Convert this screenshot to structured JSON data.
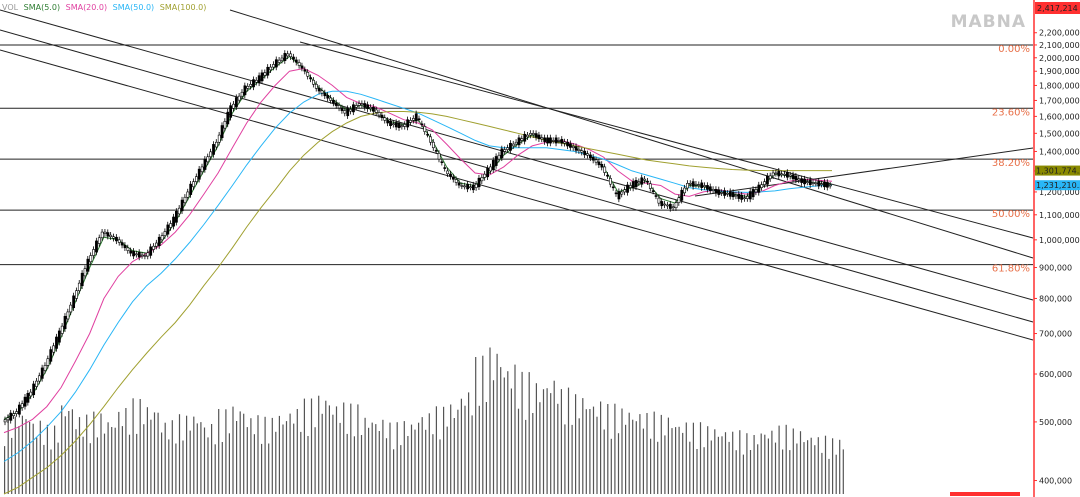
{
  "watermark": "MABNA",
  "legend": [
    {
      "label": "VOL",
      "color": "#999999"
    },
    {
      "label": "SMA(5.0)",
      "color": "#2e7d32"
    },
    {
      "label": "SMA(20.0)",
      "color": "#e040a0"
    },
    {
      "label": "SMA(50.0)",
      "color": "#29b6f6"
    },
    {
      "label": "SMA(100.0)",
      "color": "#a0a030"
    }
  ],
  "chart_data": {
    "type": "candlestick",
    "scale": "log",
    "ylim": [
      380000,
      2417214
    ],
    "y_ticks": [
      2200000,
      2100000,
      2000000,
      1900000,
      1800000,
      1700000,
      1600000,
      1500000,
      1400000,
      1300000,
      1200000,
      1100000,
      1000000,
      900000,
      800000,
      700000,
      600000,
      500000,
      400000
    ],
    "y_tick_labels": [
      "2,200,000",
      "2,100,000",
      "2,000,000",
      "1,900,000",
      "1,800,000",
      "1,700,000",
      "1,600,000",
      "1,500,000",
      "1,400,000",
      "1,300,000",
      "1,200,000",
      "1,100,000",
      "1,000,000",
      "900,000",
      "800,000",
      "700,000",
      "600,000",
      "500,000",
      "400,000"
    ],
    "top_value_label": "2,417,214",
    "price_tags": [
      {
        "text": "1,301,774.2",
        "color": "#8a8a00"
      },
      {
        "text": "1,231,210.5",
        "color": "#29b6f6"
      }
    ],
    "close_path": [
      500000,
      520000,
      560000,
      620000,
      700000,
      800000,
      920000,
      1030000,
      1000000,
      950000,
      940000,
      1000000,
      1080000,
      1200000,
      1320000,
      1450000,
      1650000,
      1780000,
      1850000,
      1950000,
      2030000,
      1920000,
      1780000,
      1700000,
      1620000,
      1680000,
      1640000,
      1560000,
      1540000,
      1600000,
      1450000,
      1300000,
      1230000,
      1220000,
      1300000,
      1400000,
      1450000,
      1500000,
      1460000,
      1460000,
      1420000,
      1380000,
      1320000,
      1180000,
      1230000,
      1260000,
      1150000,
      1130000,
      1240000,
      1230000,
      1200000,
      1190000,
      1170000,
      1220000,
      1290000,
      1280000,
      1250000,
      1240000,
      1230000
    ],
    "sma_lines": {
      "sma5": [
        505000,
        520000,
        555000,
        610000,
        690000,
        790000,
        900000,
        1010000,
        1000000,
        960000,
        950000,
        990000,
        1070000,
        1180000,
        1300000,
        1430000,
        1620000,
        1760000,
        1840000,
        1930000,
        2010000,
        1920000,
        1790000,
        1710000,
        1640000,
        1670000,
        1630000,
        1570000,
        1550000,
        1580000,
        1460000,
        1320000,
        1240000,
        1230000,
        1290000,
        1380000,
        1440000,
        1490000,
        1460000,
        1450000,
        1420000,
        1380000,
        1320000,
        1200000,
        1220000,
        1250000,
        1170000,
        1150000,
        1230000,
        1225000,
        1200000,
        1190000,
        1180000,
        1220000,
        1285000,
        1275000,
        1250000,
        1240000,
        1232000
      ],
      "sma20": [
        480000,
        490000,
        505000,
        530000,
        570000,
        630000,
        700000,
        800000,
        870000,
        920000,
        950000,
        980000,
        1030000,
        1100000,
        1190000,
        1290000,
        1420000,
        1560000,
        1690000,
        1800000,
        1900000,
        1920000,
        1870000,
        1800000,
        1720000,
        1680000,
        1660000,
        1620000,
        1580000,
        1560000,
        1520000,
        1440000,
        1360000,
        1290000,
        1280000,
        1320000,
        1380000,
        1430000,
        1450000,
        1460000,
        1440000,
        1410000,
        1370000,
        1300000,
        1250000,
        1240000,
        1230000,
        1190000,
        1180000,
        1200000,
        1210000,
        1200000,
        1190000,
        1200000,
        1230000,
        1250000,
        1260000,
        1255000,
        1250000
      ],
      "sma50": [
        430000,
        445000,
        465000,
        490000,
        520000,
        560000,
        610000,
        670000,
        730000,
        790000,
        840000,
        880000,
        930000,
        990000,
        1060000,
        1140000,
        1230000,
        1330000,
        1430000,
        1530000,
        1620000,
        1690000,
        1740000,
        1760000,
        1760000,
        1740000,
        1710000,
        1680000,
        1650000,
        1620000,
        1580000,
        1540000,
        1500000,
        1460000,
        1430000,
        1420000,
        1420000,
        1420000,
        1420000,
        1410000,
        1400000,
        1380000,
        1360000,
        1330000,
        1300000,
        1280000,
        1260000,
        1240000,
        1220000,
        1210000,
        1205000,
        1200000,
        1198000,
        1200000,
        1205000,
        1215000,
        1222000,
        1228000,
        1231210
      ],
      "sma100": [
        380000,
        390000,
        405000,
        420000,
        440000,
        465000,
        495000,
        530000,
        570000,
        610000,
        650000,
        690000,
        730000,
        780000,
        840000,
        900000,
        970000,
        1050000,
        1130000,
        1210000,
        1300000,
        1380000,
        1450000,
        1510000,
        1560000,
        1600000,
        1620000,
        1630000,
        1630000,
        1625000,
        1615000,
        1600000,
        1580000,
        1560000,
        1540000,
        1520000,
        1500000,
        1480000,
        1460000,
        1445000,
        1430000,
        1415000,
        1400000,
        1385000,
        1370000,
        1355000,
        1345000,
        1335000,
        1325000,
        1318000,
        1312000,
        1307000,
        1304000,
        1302000,
        1301774,
        1301774,
        1301774,
        1301774,
        1301774
      ]
    },
    "fibonacci": [
      {
        "label": "0.00%",
        "value": 2100000
      },
      {
        "label": "23.60%",
        "value": 1650000
      },
      {
        "label": "38.20%",
        "value": 1360000
      },
      {
        "label": "50.00%",
        "value": 1120000
      },
      {
        "label": "61.80%",
        "value": 910000
      }
    ],
    "volume": [
      300,
      320,
      280,
      260,
      350,
      300,
      310,
      290,
      330,
      360,
      340,
      280,
      300,
      310,
      270,
      320,
      340,
      300,
      290,
      310,
      330,
      360,
      380,
      350,
      340,
      300,
      290,
      270,
      280,
      310,
      330,
      350,
      400,
      520,
      560,
      500,
      460,
      430,
      450,
      400,
      380,
      360,
      340,
      330,
      320,
      310,
      300,
      280,
      270,
      260,
      250,
      240,
      230,
      250,
      260,
      250,
      230,
      220,
      210
    ]
  }
}
